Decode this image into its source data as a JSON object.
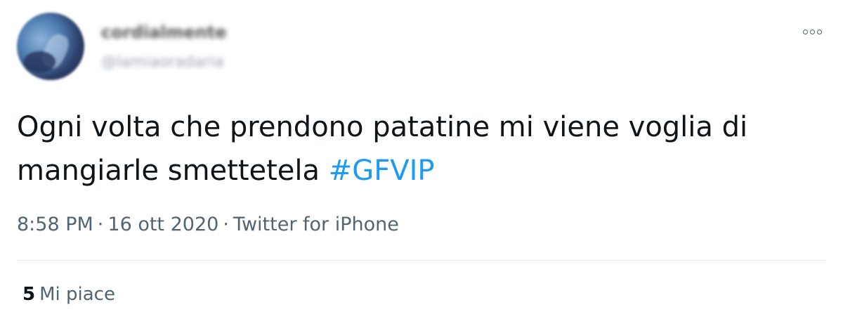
{
  "user": {
    "display_name": "cordialmente",
    "handle": "@lamiaoradaria",
    "avatar_icon": "user-avatar"
  },
  "header": {
    "more_icon": "more-options-icon"
  },
  "tweet": {
    "text": "Ogni volta che prendono patatine mi viene voglia di mangiarle smettetela ",
    "hashtag": "#GFVIP"
  },
  "meta": {
    "time": "8:58 PM",
    "separator1": "·",
    "date": "16 ott 2020",
    "separator2": "·",
    "source": "Twitter for iPhone"
  },
  "stats": {
    "likes_count": "5",
    "likes_label": "Mi piace"
  },
  "colors": {
    "hashtag": "#1d9bf0",
    "text": "#0f1419",
    "secondary": "#536471",
    "divider": "#e1e8ed"
  }
}
